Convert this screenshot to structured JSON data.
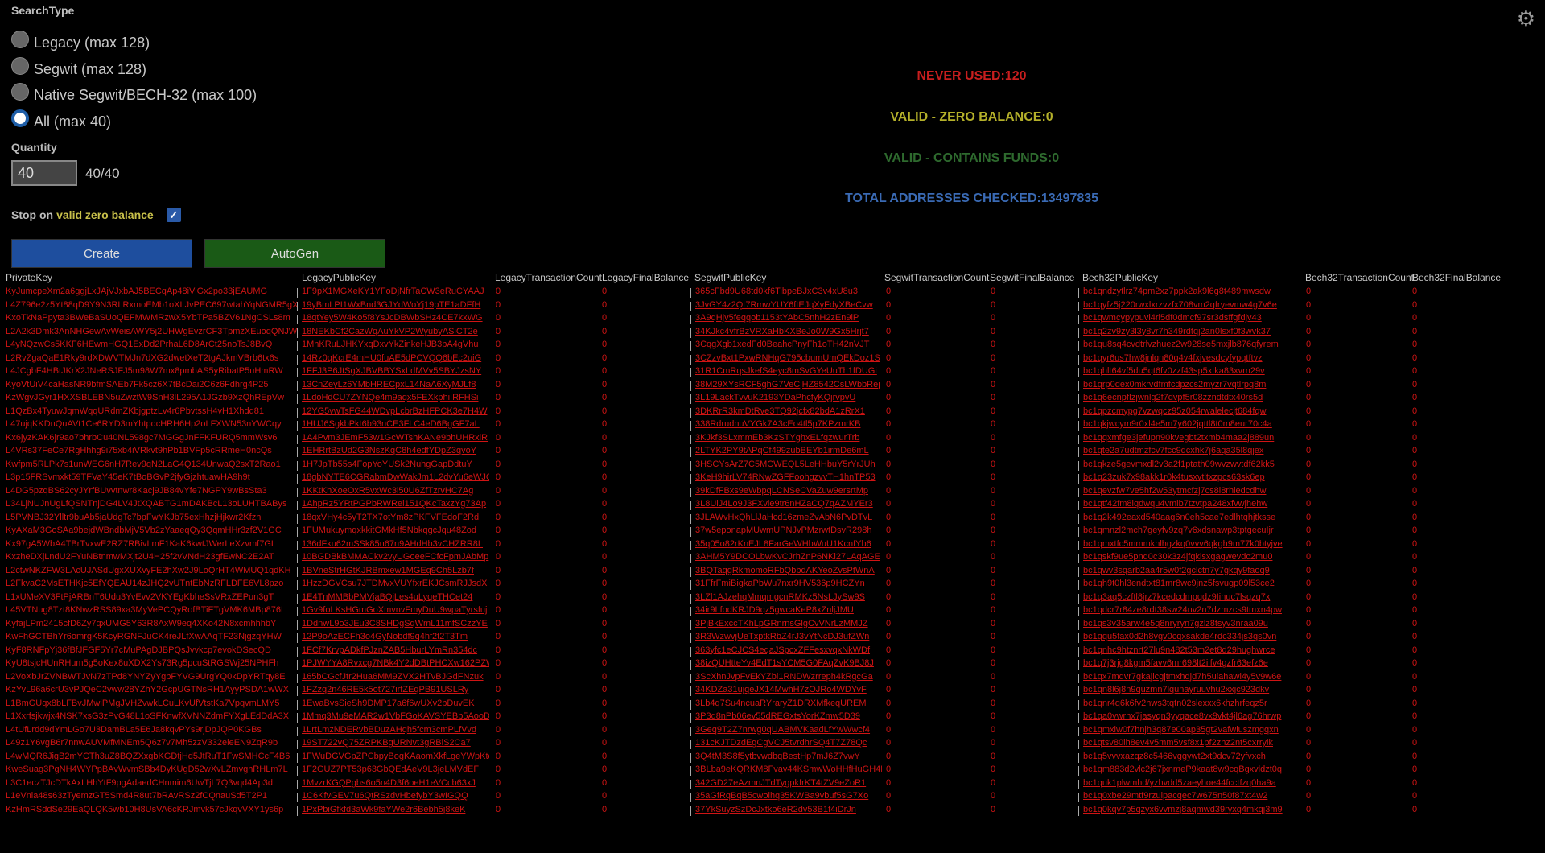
{
  "search_type": {
    "title": "SearchType",
    "options": [
      {
        "label": "Legacy (max 128)",
        "checked": false
      },
      {
        "label": "Segwit (max 128)",
        "checked": false
      },
      {
        "label": "Native Segwit/BECH-32 (max 100)",
        "checked": false
      },
      {
        "label": "All (max 40)",
        "checked": true
      }
    ]
  },
  "quantity": {
    "title": "Quantity",
    "value": "40",
    "count_text": "40/40"
  },
  "stop_on": {
    "prefix": "Stop on",
    "highlight": "valid zero balance",
    "checked": true
  },
  "buttons": {
    "create": "Create",
    "autogen": "AutoGen"
  },
  "stats": {
    "never_used": "NEVER USED:120",
    "valid_zero": "VALID - ZERO BALANCE:0",
    "valid_funds": "VALID - CONTAINS FUNDS:0",
    "total_checked": "TOTAL ADDRESSES CHECKED:13497835"
  },
  "colors": {
    "never_used": "#c81e1e",
    "valid_zero": "#b4b02a",
    "valid_funds": "#2e6a2e",
    "total_checked": "#3a6ab4",
    "row_text": "#d01414"
  },
  "table": {
    "headers": [
      "PrivateKey",
      "LegacyPublicKey",
      "LegacyTransactionCount",
      "LegacyFinalBalance",
      "SegwitPublicKey",
      "SegwitTransactionCount",
      "SegwitFinalBalance",
      "Bech32PublicKey",
      "Bech32TransactionCount",
      "Bech32FinalBalance"
    ],
    "rows": [
      [
        "KyJumcpeXm2a6ggjLxJAjVJxbAJ5BECqAp48iViGx2po33jEAUMG",
        "1F9pX1MGXeKY1YFoDjNfrTaCW3eRuCYAAJ",
        "0",
        "0",
        "365cFbd9U68td0kf6TibpeBJxC3v4xU8u3",
        "0",
        "0",
        "bc1qndzytlrz74pm2xz7ppk2ak9l6g8t489mwsdw",
        "0",
        "0"
      ],
      [
        "L4Z796e2z5Yt88qD9Y9N3RLRxmoEMb1oXLJvPEC697wtahYqNGMR5gXV",
        "19yBmLPI1WxBnd3GJYdWoYj19pTE1aDFfH",
        "0",
        "0",
        "3JvGY4z2Qt7RmwYUY6ftEJqXyFdyXBeCvw",
        "0",
        "0",
        "bc1qyfz5j220rwxlxrzvzfx708vm2qfryevmw4g7v6e",
        "0",
        "0"
      ],
      [
        "KxoTkNaPpyta3BWeBaSUoQEFMWMRzwX5YbTPa5BZV61NgCSLs8m",
        "18qtYey5W4Ko5f8YsJcDBWbSHz4CE7kxWG",
        "0",
        "0",
        "3A9qHjv5feqqob1153tYAbC5nhH2zEn9iP",
        "0",
        "0",
        "bc1qwmcypypuvl4rl5df0dmcf97sr3dsffgfdjv43",
        "0",
        "0"
      ],
      [
        "L2A2k3Dmk3AnNHGewAvWeisAWY5j2UHWgEvzrCF3TpmzXEuoqQNJWv",
        "18NEKbCf2CazWqAuYkVP2WyubyASiCT2e",
        "0",
        "0",
        "34KJkc4vfrBzVRXaHbKXBeJo0W9Gx5Hrjt7",
        "0",
        "0",
        "bc1q2zv9zy3l3y8vr7h349rdtqj2an0lsxf0f3wvk37",
        "0",
        "0"
      ],
      [
        "L4yNQzwCs5KKF6HEwmHGQ1ExDd2PrhaL6D8ArCt25noTsJ8BvQ",
        "1MhKRuLJHKYxqDxvYkZinkeHJB3bA4gVhu",
        "0",
        "0",
        "3CqgXgb1xedFd0BeahcPnyFh1oTH42nVJT",
        "0",
        "0",
        "bc1qu8sq4cvdtrlvzhuez2w928se5mxjlb876qfyrem",
        "0",
        "0"
      ],
      [
        "L2RvZgaQaE1Rky9rdXDWVTMJn7dXG2dwetXeT2tgAJkmVBrb6tx6s",
        "14Rz0qKcrE4mHU0fuAE5dPCVQQ6bEc2uiG",
        "0",
        "0",
        "3CZzvBxt1PxwRNHqG795cbumUmQEkDoz1S",
        "0",
        "0",
        "bc1qyr6us7hw8jnlqn80q4v4fxjvesdcyfypqtftvz",
        "0",
        "0"
      ],
      [
        "L4JCgbF4HBtJKrX2JNeRSJFJ5m98W7mx8pmbAS5yRibatP5uHmRW",
        "1FFJ3P6JtSgXJBVBBYSxLdMVv5SBYJzsNY",
        "0",
        "0",
        "31R1CmRqsJkefS4eyc8mSvGYeUuTh1fDUGi",
        "0",
        "0",
        "bc1qhlt64vf5du5qt6fv0zzf43sp5xtka83xvrn29v",
        "0",
        "0"
      ],
      [
        "KyoVtUiV4caHasNR9bfmSAEb7Fk5cz6X7tBcDai2C6z6Fdhrg4P25",
        "13CnZeyLz6YMbHRECpxL14NaA6XyMJLf8",
        "0",
        "0",
        "38M29XYsRCF5ghG7VeCjHZ8542CsLWbbRej",
        "0",
        "0",
        "bc1qrp0dex0mkrvdfmfcdpzcs2myzr7vqtlrpq8m",
        "0",
        "0"
      ],
      [
        "KzWgvJGyr1HXXSBLEBN5uZwztW9SnH3lL295A1JGzb9XzQhREpVw",
        "1LdoHdCU7ZYNQe4m9aqx5FEXkphiIRFHSi",
        "0",
        "0",
        "3L19LackTvvuK2193YDaPhcfyKQjrvpvU",
        "0",
        "0",
        "bc1q6ecnpfIzjwnlg2f7dvpf5r08zzndtdtx40rs5d",
        "0",
        "0"
      ],
      [
        "L1QzBx4TyuwJqmWqqURdmZKbjgptzLv4r6PbvtssH4vH1Xhdq81",
        "12YG5vwTsFG44WDvpLcbrBzHFPCK3e7H4W",
        "0",
        "0",
        "3DKRrR3kmDtRve3TQ92jcfx82bdA1zRrX1",
        "0",
        "0",
        "bc1qpzcmypg7vzwqcz95z054rwalelecjt684fqw",
        "0",
        "0"
      ],
      [
        "L47ujqKKDnQuAVt1Ce6RYD3mYhtpdcHRH6Hp2oLFXWN53nYWCqy",
        "1HUJ6SgkbPkt6b93nCE3FLC4eD6BgGF7aL",
        "0",
        "0",
        "338RdrudnuVYGk7A3cEo4tl5p7KPzmrKB",
        "0",
        "0",
        "bc1qkjwcym9r0xl4e5m7y602jqttl8t0m8eur70c4a",
        "0",
        "0"
      ],
      [
        "Kx6jyzKAK6jr9ao7bhrbCu40NL598gc7MGGgJnFFKFURQ5mmWsv6",
        "1A4Pvm3JEmF53w1GcWTshKANe9bhUHRxiR",
        "0",
        "0",
        "3KJkf3SLxmmEb3KzSTYghxELfqzwurTrb",
        "0",
        "0",
        "bc1qqxmfge3jefupn90kvegbt2txmb4maa2j889un",
        "0",
        "0"
      ],
      [
        "L4VRs37FeCe7RgHhhg9i75xb4iVRkvt9hPb1BVFp5cRRmeH0ncQs",
        "1EHRrtBzUd2G3NszKqC8h4edfYDpZ3qvoY",
        "0",
        "0",
        "2LTYK2PY9tAPqCf499zubBEYb1irmDe6mL",
        "0",
        "0",
        "bc1qte2a7udtmzfcv7fcc9dcxhk7j6aqa35l8qjex",
        "0",
        "0"
      ],
      [
        "Kwfpm5RLPk7s1unWEG6nH7Rev9qN2LaG4Q134UnwaQ2sxT2Rao1",
        "1H7JpTb55s4FopYoYUSk2NuhgGapDdtuY",
        "0",
        "0",
        "3HSCYsArZ7C5MCWEQL5LeHHbuY5rYrJUh",
        "0",
        "0",
        "bc1qkze5gevmxdl2v3a2f1ptath09wvzwvtdf62kk5",
        "0",
        "0"
      ],
      [
        "L3p15FRSvmxkt59TFVaY45eK7tBoBGvP2jfyGjzhtuawHA9h9t",
        "18gbNYTE6CGRabmDwWakJm1L2dvYu6eWJG",
        "0",
        "0",
        "3KeH9hirLV74RNwZGFFoohgzvvTH1hnTP53",
        "0",
        "0",
        "bc1q23zuk7x98akk1r0k4tusxvtltxzpcs63sk6ep",
        "0",
        "0"
      ],
      [
        "L4DG5pzqBS62cyJYrfBUvvtnwr8Kacj9JB84vYfe7NGPY9wBsSta3",
        "1KKtKhXoeOxR5vxWc3i50U6ZfTzrvHC7Ag",
        "0",
        "0",
        "39kDfFBxs9eWbpqLCNSeCVaZuw9ersrtMp",
        "0",
        "0",
        "bc1qevzfw7ve5hf2w53ytmcfzj7cs8l8rhledcdhw",
        "0",
        "0"
      ],
      [
        "L34LjNUJnUgLfQSNTnjDG4LV4JtXQABTG1mDAKBcL13oLUHTBABys",
        "1AhpRz5YRtPGPbRWRei151QKcTaxzYg73Ap",
        "0",
        "0",
        "3L8UiJ4Lo9J3FXvle9tr6nHZaCQ7qAZMYEr3",
        "0",
        "0",
        "bc1qtf42fm8lqdwqu4vmlb7tzvtpa248xfvwjhehw",
        "0",
        "0"
      ],
      [
        "L5PVNBJ32Ylltr9buAb5jaUdgTc7bpFwYKJb75exHhzjHjkwr2Kfzh",
        "18qxVHy4c5yT2TX7otYm8zPKFVFEdoF2Rd",
        "0",
        "0",
        "3JLAWvHxQhLlJaHcd16zmeZvAbN6PvDTvL",
        "0",
        "0",
        "bc1q2k492eaxd540aag6n0eh5cae7edlhtqhjtksse",
        "0",
        "0"
      ],
      [
        "KyAXaM3GoSAa9bejdWBndbMjV5Vb2zYaaeqQy3QqmHHr3zf2V1GC",
        "1FUMukuymqxkkitGMkHf5NbkqgcJqu48Zod",
        "0",
        "0",
        "37w5eponapMUwmUPNJvPMzrwtDsvR298h",
        "0",
        "0",
        "bc1qmnzl2mch7geyfv9zq7v6xdsnawp3tptgecuIjr",
        "0",
        "0"
      ],
      [
        "Kx97gA5WbA4TBrTvxwE2RZ7RBivLmF1KaK6kwtJWerLeXzvmf7GL",
        "136dFku62mSSk85n67n9AHdHb3vCHZRR8L",
        "0",
        "0",
        "35q05o82rKnEJL8FarGeWHbWuU1KcnfYb6",
        "0",
        "0",
        "bc1qmxtfc5mmmkhlhgzkq0vvv6qkgh9m77k0btyjve",
        "0",
        "0"
      ],
      [
        "KxzheDXjLndU2FYuNBtnmwMXjt2U4H25f2vVNdH23gfEwNC2E2AT",
        "10BGDBkBMMACkv2vyUGoeeFCfcFpmJAbMp",
        "0",
        "0",
        "3AHM5Y9DCOLbwKvCJrhZnP6NKl27LAqAGE",
        "0",
        "0",
        "bc1qskf9ue5pnd0c30k3z4jfqklsxgagwevdc2mu0",
        "0",
        "0"
      ],
      [
        "L2ctwNKZFW3LAcUJASdUgxXUXvyFE2hXw2J9LoQrHT4WMUQ1qdKH",
        "1BVneStrHGtKJRBmxew1MGEq9Ch5Lzb7f",
        "0",
        "0",
        "3BQTaqgRkmomoRFbQbbdAKYeoZvsPtWnA",
        "0",
        "0",
        "bc1qwv3sqarb2aa4r5w0f2gclctn7y7gkqy9faoq9",
        "0",
        "0"
      ],
      [
        "L2FkvaC2MsETHKjc5EfYQEAU14zJHQ2vUTntEbNzRFLDFE6VL8pzo",
        "1HzzDGVCsu7JTDMvxVUYfxrEKJCsmRJJsdX",
        "0",
        "0",
        "31FfrFmiBigkaPbWu7nxr9HV536p9HCZYn",
        "0",
        "0",
        "bc1qh9t0hl3endtxt81mr8wc9jnz5fsvugp09l53ce2",
        "0",
        "0"
      ],
      [
        "L1xUMeXV3FtPjARBnT6Udu3YvEvv2VKYEgKbheSsVRxZEPun3gT",
        "1E4TnMMBbPMVjaBQjLes4uLyqeTHCet24",
        "0",
        "0",
        "3LZl1AJzehqMmqmgcnRMKz5NsLJySw9S",
        "0",
        "0",
        "bc1q3aq5czftl8jrz7kcedcdmpqdz9Iinuc7lsqzq7x",
        "0",
        "0"
      ],
      [
        "L45VTNug8Tzt8KNwzRSS89xa3MyVePCQyRofBTiFTgVMK6MBp876L",
        "1Gv9foLKsHGmGoXmvnvFmyDuU9wpaTyrsfuj",
        "0",
        "0",
        "34ir9LfodKRJD9qz5gwcaKeP8xZnljJMU",
        "0",
        "0",
        "bc1qdcr7r84ze8rdt38sw24nv2n7dzmzcs9tmxn4pw",
        "0",
        "0"
      ],
      [
        "KyfajLPm2415cfD6Zy7qxUMG5Y63R8AxW9eq4XKo42N8xcmhhhbY",
        "1DdnwL9o3JEu3C8SHDgSqWmL11mfSCzzYE",
        "0",
        "0",
        "3PjBkExccTKhLpGRnrnsGlgCvVNrLzMMJZ",
        "0",
        "0",
        "bc1qs3v35arw4e5q8nryryn7gzlz8tsyv3nraa09u",
        "0",
        "0"
      ],
      [
        "KwFhGCTBhYr6omrgK5KcyRGNFJuCK4reJLfXwAAqTF23NjgzqYHW",
        "12P9oAzECFh3o4GyNobdf9q4hf2t2T3Tm",
        "0",
        "0",
        "3R3WzwvjUeTxptkRbZ4rJ3vYtNcDJ3ufZWn",
        "0",
        "0",
        "bc1qqu5fax0d2h8vgv0cqxsakde4rdc334js3qs0vn",
        "0",
        "0"
      ],
      [
        "KyF8RNFpYj36fBfJFGF5Yr7cMuPAgDJBPQsJvvkcp7evokDSecQD",
        "1FCf7KrvpADkfPJznZAB5HburLYmRn354dc",
        "0",
        "0",
        "363yfc1eCJCS4eqaJSpcxZFFesxvqxNkWDf",
        "0",
        "0",
        "bc1qnhc9htznrt27lu9n482t53m2et8d29hughwrce",
        "0",
        "0"
      ],
      [
        "KyU8tsjcHUnRHum5g5oKex8uXDX2Ys73Rg5pcuStRGSWj25NPHFh",
        "1PJWYYA8Rvxcg7NBk4Y2dDBtPHCXw162PZW",
        "0",
        "0",
        "38izQUHtteYv4EdT1sYCM5G0FAqZvK9BJ8J",
        "0",
        "0",
        "bc1q7j3rjg8kgm5favv6mr698lt2ilfv4gzfr63efz6e",
        "0",
        "0"
      ],
      [
        "L2VoXbJrZVNBWTJvN7zTPd8YNYZyYgbFYVG9UrgYQ0kDpYRTqy8E",
        "165bCGcfJtr2Hua6MM9ZVX2HTvBJGdFNzuk",
        "0",
        "0",
        "3ScXhnJvpFvEkYZbi1RNDWzrreph4kRgcGa",
        "0",
        "0",
        "bc1qx7mdvr7gkajlcgjtmxhdjd7h5ulahawl4y5v9w6e",
        "0",
        "0"
      ],
      [
        "KzYvL96a6crU3vPJQeC2vww28YZhY2GcpUGTNsRH1AyyPSDA1wWX",
        "1FZzq2n46RE5k5ot727irfZEqPB91USLRy",
        "0",
        "0",
        "34KDZa31ujqeJX14MwhH7zOJRo4WDYvF",
        "0",
        "0",
        "bc1qn8l6j8n9quzmn7lqunayruuvhu2xxjc923dkv",
        "0",
        "0"
      ],
      [
        "L1BmGUqx8bLFBvJMwiPMgJVHZvwkLCuLKvUfVtstKa7VpqvmLMY5",
        "1EwaBvsSieSh9DMP17a6f6wUXv2bDuvEK",
        "0",
        "0",
        "3Lb4q7Su4ncuaRYraryZ1DRXMfkeqUREM",
        "0",
        "0",
        "bc1qnr4q6k6fv2hws3tqtn02slexxx6khzhrfeqz5r",
        "0",
        "0"
      ],
      [
        "L1Xxrfsjkwjx4NSK7xsG3zPvG48L1oSFKnwfXVNNZdmFYXgLEdDdA3X",
        "1Mmq3Mu9eMAR2w1VbFGoKAVSYEBb5AooD5",
        "0",
        "0",
        "3P3d8nPb06ev55dREGxtsYorKZmw5D39",
        "0",
        "0",
        "bc1qa0vwrhx7jasyqn3yyqace8vx9vkt4jl6ag76hrwp",
        "0",
        "0"
      ],
      [
        "L4tUfLrdd9dYmLGo7U3DamBLa5E6Ja8kqvPYs9rjDpJQP0KGBs",
        "1LrtLmzNDERvbBDuzAHqh5fcm3cmPLfVvd",
        "0",
        "0",
        "3Geq9T2Z7nrwg0qUABMVKaadLfYwWwcf4",
        "0",
        "0",
        "bc1qmxlw0f7hnjh3q87e00ap35gt2vafwluszmgqxn",
        "0",
        "0"
      ],
      [
        "L49z1Y6vgB6r7nnwAUVMfMNEm5Q6z7v7Mh5zzV332eleEN9ZqR9b",
        "19ST722vQ75ZRPKBgURNvt3gRBiS2Ca7",
        "0",
        "0",
        "131cKJTDzdEgCgVCJ5tvrdhrSQ4T7Z78Qc",
        "0",
        "0",
        "bc1qtsv80ih8ev4v5mm5vsf8x1pf2zhz2nt5cxrrylk",
        "0",
        "0"
      ],
      [
        "L4wMQR6JigB2mYCTh3uZ8BQZXxgbKGDtjHd5JtRuT1FwSMHCcF4B6",
        "1FWuDGVGpZPCbpyBogKAaomXkfLgeYWpKtd",
        "0",
        "0",
        "3Q4tM3S8f5ytbvwdbqBestHp7mJ6Z7vwY",
        "0",
        "0",
        "bc1q5vvvxazqz8c5466vggywt2xt9dcv72yfvxch",
        "0",
        "0"
      ],
      [
        "KweSuag3PgNH4WYPpBAvWvmSBb4DyKUgD52wXvLZmvghRHLm7L",
        "1F2GUZ7PT53p63GbQEdAeV9L3jeLMVdEF",
        "0",
        "0",
        "3BLba9eKQRKM8Fvav44KSmwWoHHfHuGH4D",
        "0",
        "0",
        "bc1qm883d2vlc2j67jxnmeP9kaat8w9cqBgxvldzt0q",
        "0",
        "0"
      ],
      [
        "L3C1eczTJcDTkAxLHhYtF9pgAdaedCHnmim6UwTjL7Q3vqd4Ap3d",
        "1MvzrKGQPgbs6o5n4D3f6oeH1eVCcb63xJ",
        "0",
        "0",
        "342GD27eAzmnJTdTygpkfrKT4tZV9eZoR1",
        "0",
        "0",
        "bc1quk1plwmhd/yzhvdd5zaeyhoe44fcctfzq0ha9a",
        "0",
        "0"
      ],
      [
        "L1eVnia48s63zTyemzGT5Smd4R8ut7bRAvRSz2fCQnauSd5T2P1",
        "1C6KfvGEV7u6QtRSzdvHbefybY3wIGQQ",
        "0",
        "0",
        "35aGfRqBqB5cwolhq35KWBa9vbuf5sG7Xo",
        "0",
        "0",
        "bc1q0xbe29mtf9rzulpacqec7w675n50f87xt4w2",
        "0",
        "0"
      ],
      [
        "KzHmRSddSe29EaQLQK5wb10H8UsVA6cKRJmvk57cJkqvVXY1ys6p",
        "1PxPbiGfkfd3aWk9faYWe2r6Bebh5j8keK",
        "0",
        "0",
        "37YkSuyzSzDcJxtko6eR2dv53B1f4iDrJn",
        "0",
        "0",
        "bc1q0kqv7p5qzyx6vvmzj8aqmwd39ryxq4mkqj3m9",
        "0",
        "0"
      ]
    ]
  }
}
